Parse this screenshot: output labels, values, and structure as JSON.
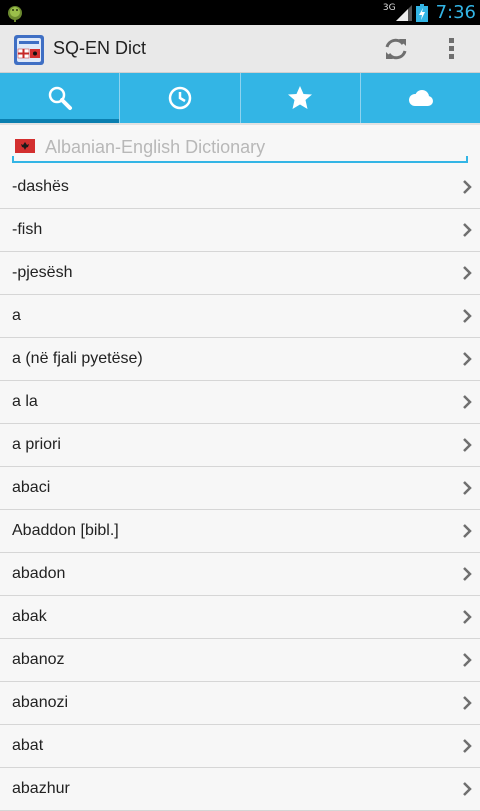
{
  "status_bar": {
    "network_label": "3G",
    "time": "7:36"
  },
  "action_bar": {
    "title": "SQ-EN Dict"
  },
  "tabs": [
    {
      "icon": "search-icon",
      "active": true
    },
    {
      "icon": "history-icon",
      "active": false
    },
    {
      "icon": "star-icon",
      "active": false
    },
    {
      "icon": "cloud-icon",
      "active": false
    }
  ],
  "search": {
    "placeholder": "Albanian-English Dictionary",
    "value": ""
  },
  "words": [
    "-dashës",
    "-fish",
    "-pjesësh",
    "a",
    "a (në fjali pyetëse)",
    "a la",
    "a priori",
    "abaci",
    "Abaddon [bibl.]",
    "abadon",
    "abak",
    "abanoz",
    "abanozi",
    "abat",
    "abazhur"
  ],
  "colors": {
    "accent": "#33b5e5",
    "action_bar": "#e9e9e9",
    "background": "#f7f7f7"
  }
}
